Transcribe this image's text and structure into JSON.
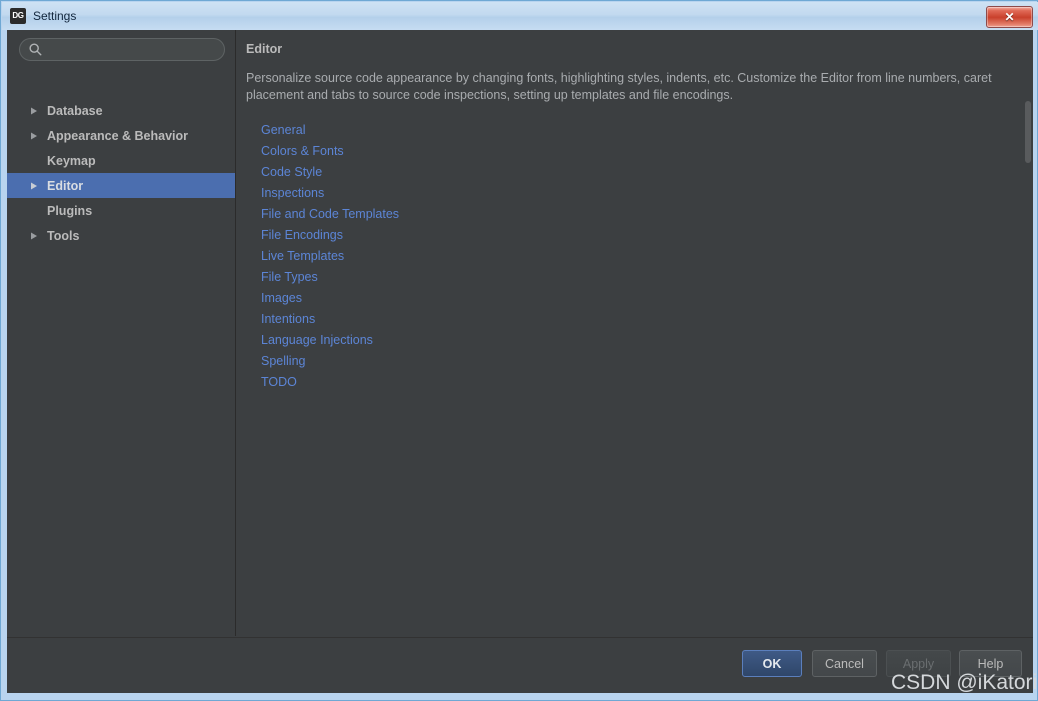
{
  "window": {
    "title": "Settings",
    "app_icon": "DG",
    "close_label": "✕"
  },
  "sidebar": {
    "search": {
      "value": "",
      "placeholder": "",
      "icon": "search-icon"
    },
    "items": [
      {
        "label": "Database",
        "expandable": true,
        "selected": false
      },
      {
        "label": "Appearance & Behavior",
        "expandable": true,
        "selected": false
      },
      {
        "label": "Keymap",
        "expandable": false,
        "selected": false
      },
      {
        "label": "Editor",
        "expandable": true,
        "selected": true
      },
      {
        "label": "Plugins",
        "expandable": false,
        "selected": false
      },
      {
        "label": "Tools",
        "expandable": true,
        "selected": false
      }
    ]
  },
  "content": {
    "title": "Editor",
    "description": "Personalize source code appearance by changing fonts, highlighting styles, indents, etc. Customize the Editor from line numbers, caret placement and tabs to source code inspections, setting up templates and file encodings.",
    "links": [
      {
        "label": "General"
      },
      {
        "label": "Colors & Fonts"
      },
      {
        "label": "Code Style"
      },
      {
        "label": "Inspections"
      },
      {
        "label": "File and Code Templates"
      },
      {
        "label": "File Encodings"
      },
      {
        "label": "Live Templates"
      },
      {
        "label": "File Types"
      },
      {
        "label": "Images"
      },
      {
        "label": "Intentions"
      },
      {
        "label": "Language Injections"
      },
      {
        "label": "Spelling"
      },
      {
        "label": "TODO"
      }
    ]
  },
  "footer": {
    "ok_label": "OK",
    "cancel_label": "Cancel",
    "apply_label": "Apply",
    "help_label": "Help"
  },
  "watermark": {
    "text": "CSDN @iKatori"
  },
  "colors": {
    "accent_selection": "#4b6eaf",
    "link": "#5c85d6",
    "panel_bg": "#3c3f41",
    "text": "#bbbbbb",
    "frame": "#b9d4ef"
  }
}
